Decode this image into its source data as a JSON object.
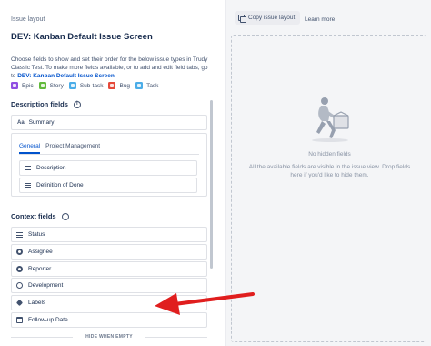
{
  "breadcrumb": "Issue layout",
  "page_title": "DEV: Kanban Default Issue Screen",
  "description": {
    "text": "Choose fields to show and set their order for the below issue types in Trudy Classic Test. To make more fields available, or to add and edit field tabs, go to",
    "link": "DEV: Kanban Default Issue Screen",
    "tail": "."
  },
  "issue_types": [
    {
      "label": "Epic",
      "color": "#904ee2",
      "icon": "epic-icon"
    },
    {
      "label": "Story",
      "color": "#63ba3c",
      "icon": "story-icon"
    },
    {
      "label": "Sub-task",
      "color": "#4bade8",
      "icon": "subtask-icon"
    },
    {
      "label": "Bug",
      "color": "#e5493a",
      "icon": "bug-icon"
    },
    {
      "label": "Task",
      "color": "#4bade8",
      "icon": "task-icon"
    }
  ],
  "description_fields": {
    "heading": "Description fields",
    "summary_prefix": "Aa",
    "summary": "Summary",
    "tabs": [
      {
        "label": "General"
      },
      {
        "label": "Project Management"
      }
    ],
    "tab_fields": [
      {
        "label": "Description"
      },
      {
        "label": "Definition of Done"
      }
    ]
  },
  "context_fields": {
    "heading": "Context fields",
    "items": [
      {
        "label": "Status",
        "icon": "lines-icon"
      },
      {
        "label": "Assignee",
        "icon": "user-icon"
      },
      {
        "label": "Reporter",
        "icon": "user-icon"
      },
      {
        "label": "Development",
        "icon": "development-icon"
      },
      {
        "label": "Labels",
        "icon": "tag-icon"
      },
      {
        "label": "Follow-up Date",
        "icon": "calendar-icon"
      }
    ],
    "hide_when_empty": "HIDE WHEN EMPTY"
  },
  "right_panel": {
    "copy_button": "Copy issue layout",
    "learn_more": "Learn more",
    "no_hidden_title": "No hidden fields",
    "no_hidden_desc": "All the available fields are visible in the issue view. Drop fields here if you'd like to hide them."
  },
  "colors": {
    "accent": "#0052cc",
    "annotation_arrow": "#e01e1e"
  }
}
